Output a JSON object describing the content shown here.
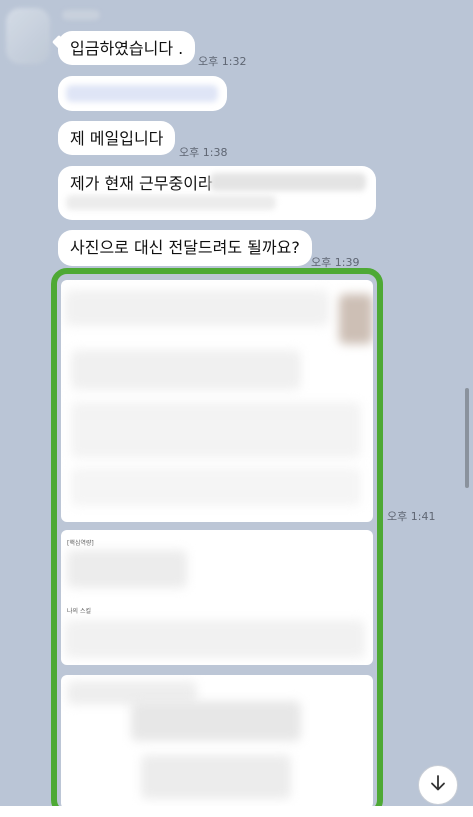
{
  "messages": [
    {
      "text": "입금하였습니다 .",
      "time": "오후 1:32"
    },
    {
      "text": "제 메일입니다",
      "time": "오후 1:38"
    },
    {
      "text": "제가 현재 근무중이라"
    },
    {
      "text": "사진으로 대신 전달드려도 될까요?",
      "time": "오후 1:39"
    }
  ],
  "photo": {
    "time": "오후 1:41",
    "card2_label_a": "[핵심역량]",
    "card2_label_b": "나의 스킬"
  },
  "colors": {
    "background": "#bac5d6",
    "bubble": "#ffffff",
    "highlight": "#4ea935"
  },
  "icons": {
    "scroll_down": "arrow-down-icon"
  }
}
